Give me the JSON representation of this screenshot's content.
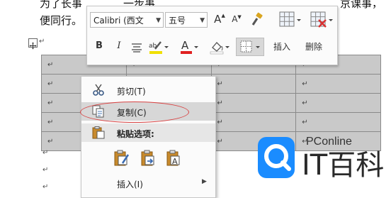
{
  "document": {
    "line1_left": "为了长事",
    "line1_mid": "一步事",
    "line1_right": "京课事，",
    "line2": "便同行。",
    "para_mark": "↵",
    "anchor_icon": "move-anchor-icon",
    "table_rows": [
      [
        "↵",
        "↵",
        "↵",
        "↵"
      ],
      [
        "↵",
        "↵",
        "↵",
        "↵"
      ],
      [
        "↵",
        "↵",
        "↵",
        "↵"
      ],
      [
        "↵",
        "↵",
        "↵",
        "↵"
      ],
      [
        "↵",
        "↵",
        "↵",
        "↵"
      ]
    ],
    "trailing_paras": [
      "↵",
      "↵",
      "↵"
    ]
  },
  "mini_toolbar": {
    "font_name": "Calibri (西文",
    "font_size": "五号",
    "grow_font": "A",
    "shrink_font": "A",
    "bold": "B",
    "italic": "I",
    "font_color": "A",
    "insert_label": "插入",
    "delete_label": "删除"
  },
  "context_menu": {
    "items": [
      {
        "label": "剪切(T)",
        "icon": "scissors-icon"
      },
      {
        "label": "复制(C)",
        "icon": "copy-icon"
      },
      {
        "label": "粘贴选项:",
        "icon": "paste-icon"
      },
      {
        "label": "插入(I)",
        "icon": ""
      }
    ]
  },
  "watermark": {
    "brand": "PConline",
    "name": "IT百科"
  },
  "colors": {
    "highlight_yellow": "#f0e000",
    "font_red": "#e02020",
    "ellipse_red": "#d84343",
    "watermark_blue": "#1a8cff"
  }
}
